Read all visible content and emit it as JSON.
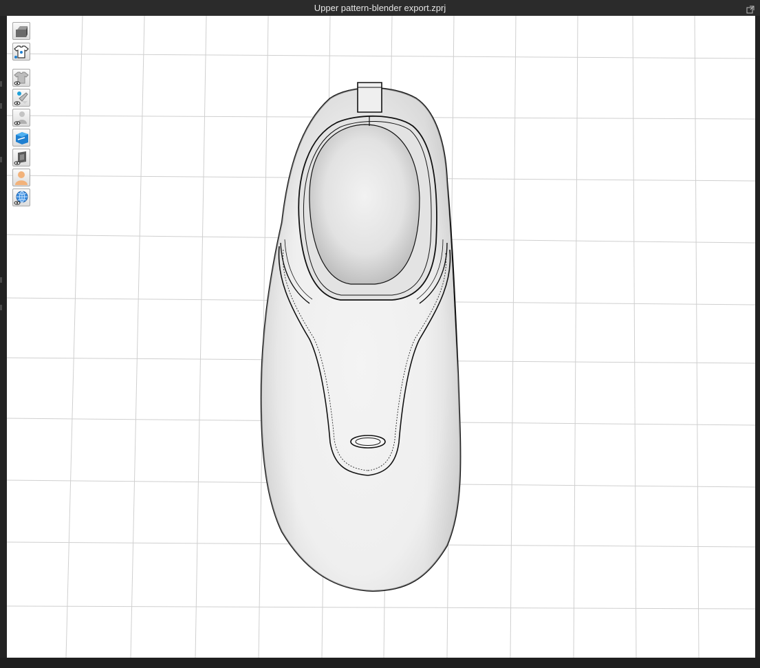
{
  "window": {
    "title": "Upper pattern-blender export.zprj"
  },
  "toolbar": {
    "buttons": [
      {
        "name": "avatar-display-button",
        "icon": "avatar-block-icon"
      },
      {
        "name": "garment-display-button",
        "icon": "tshirt-icon"
      },
      {
        "name": "show-garment-button",
        "icon": "shirt-eye-icon"
      },
      {
        "name": "show-pins-button",
        "icon": "pin-eye-icon"
      },
      {
        "name": "show-avatar-button",
        "icon": "avatar-eye-icon"
      },
      {
        "name": "show-fabric-button",
        "icon": "fabric-blue-icon"
      },
      {
        "name": "show-texture-button",
        "icon": "texture-eye-icon"
      },
      {
        "name": "avatar-skin-button",
        "icon": "skin-avatar-icon"
      },
      {
        "name": "environment-button",
        "icon": "globe-icon"
      }
    ]
  },
  "colors": {
    "accent_blue": "#1e7fd0",
    "grid": "#d0d0d0",
    "background": "#ffffff",
    "titlebar": "#2b2b2b"
  }
}
